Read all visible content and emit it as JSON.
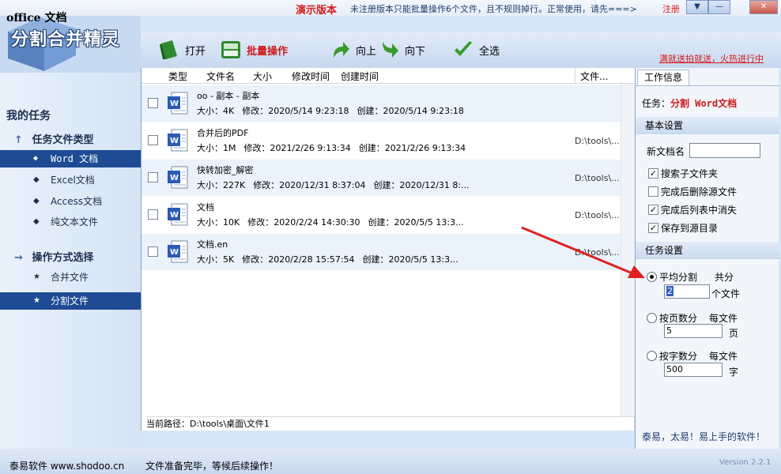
{
  "colors": {
    "accent": "#1e4b93",
    "demo_red": "#d61a1a",
    "arrow_red": "#e02020"
  },
  "window": {
    "demo_label": "演示版本",
    "notice": "未注册版本只能批量操作6个文件，且不规则掉行。正常使用，请先===>",
    "register": "注册",
    "menu_icon": "chevron-down-icon",
    "min_label": "—",
    "close_label": "✕"
  },
  "logo": {
    "office": "office 文档",
    "title": "分割合并精灵"
  },
  "sidebar": {
    "my_tasks": "我的任务",
    "types_head": "任务文件类型",
    "types": [
      {
        "label": "Word 文档",
        "active": true
      },
      {
        "label": "Excel文档",
        "active": false
      },
      {
        "label": "Access文档",
        "active": false
      },
      {
        "label": "纯文本文件",
        "active": false
      }
    ],
    "ops_head": "操作方式选择",
    "ops": [
      {
        "label": "合并文件",
        "active": false
      },
      {
        "label": "分割文件",
        "active": true
      }
    ]
  },
  "toolbar": {
    "open": "打开",
    "batch": "批量操作",
    "up": "向上",
    "down": "向下",
    "select_all": "全选",
    "promo": "满就送拍就送，火热进行中"
  },
  "list": {
    "columns": {
      "type": "类型",
      "name": "文件名",
      "size": "大小",
      "mtime": "修改时间",
      "ctime": "创建时间",
      "path": "文件..."
    },
    "rows": [
      {
        "name": "oo - 副本 - 副本",
        "size": "大小：4K",
        "modified": "修改：2020/5/14 9:23:18",
        "created": "创建：2020/5/14 9:23:18",
        "path": ""
      },
      {
        "name": "合并后的PDF",
        "size": "大小：1M",
        "modified": "修改：2021/2/26 9:13:34",
        "created": "创建：2021/2/26 9:13:34",
        "path": "D:\\tools\\..."
      },
      {
        "name": "快转加密_解密",
        "size": "大小：227K",
        "modified": "修改：2020/12/31 8:37:04",
        "created": "创建：2020/12/31 8:...",
        "path": "D:\\tools\\..."
      },
      {
        "name": "文档",
        "size": "大小：10K",
        "modified": "修改：2020/2/24 14:30:30",
        "created": "创建：2020/5/5 13:3...",
        "path": "D:\\tools\\..."
      },
      {
        "name": "文档.en",
        "size": "大小：5K",
        "modified": "修改：2020/2/28 15:57:54",
        "created": "创建：2020/5/5 13:3...",
        "path": "D:\\tools\\..."
      }
    ],
    "current_path": "当前路径：D:\\tools\\桌面\\文件1"
  },
  "panel": {
    "tab": "工作信息",
    "task_prefix": "任务：",
    "task_value": "分割 Word文档",
    "basic_head": "基本设置",
    "newname_label": "新文档名",
    "newname_value": "",
    "checkboxes": [
      {
        "label": "搜索子文件夹",
        "checked": true
      },
      {
        "label": "完成后删除源文件",
        "checked": false
      },
      {
        "label": "完成后列表中消失",
        "checked": true
      },
      {
        "label": "保存到源目录",
        "checked": true
      }
    ],
    "task_head": "任务设置",
    "even_label": "平均分割",
    "even_total": "共分",
    "even_value": "2",
    "even_unit": "个文件",
    "pages_label": "按页数分",
    "pages_per": "每文件",
    "pages_value": "5",
    "pages_unit": "页",
    "chars_label": "按字数分",
    "chars_per": "每文件",
    "chars_value": "500",
    "chars_unit": "字",
    "slogan": "泰易，太易！易上手的软件！"
  },
  "status": {
    "company": "泰易软件 www.shodoo.cn",
    "message": "文件准备完毕，等候后续操作！",
    "version": "Version 2.2.1"
  }
}
